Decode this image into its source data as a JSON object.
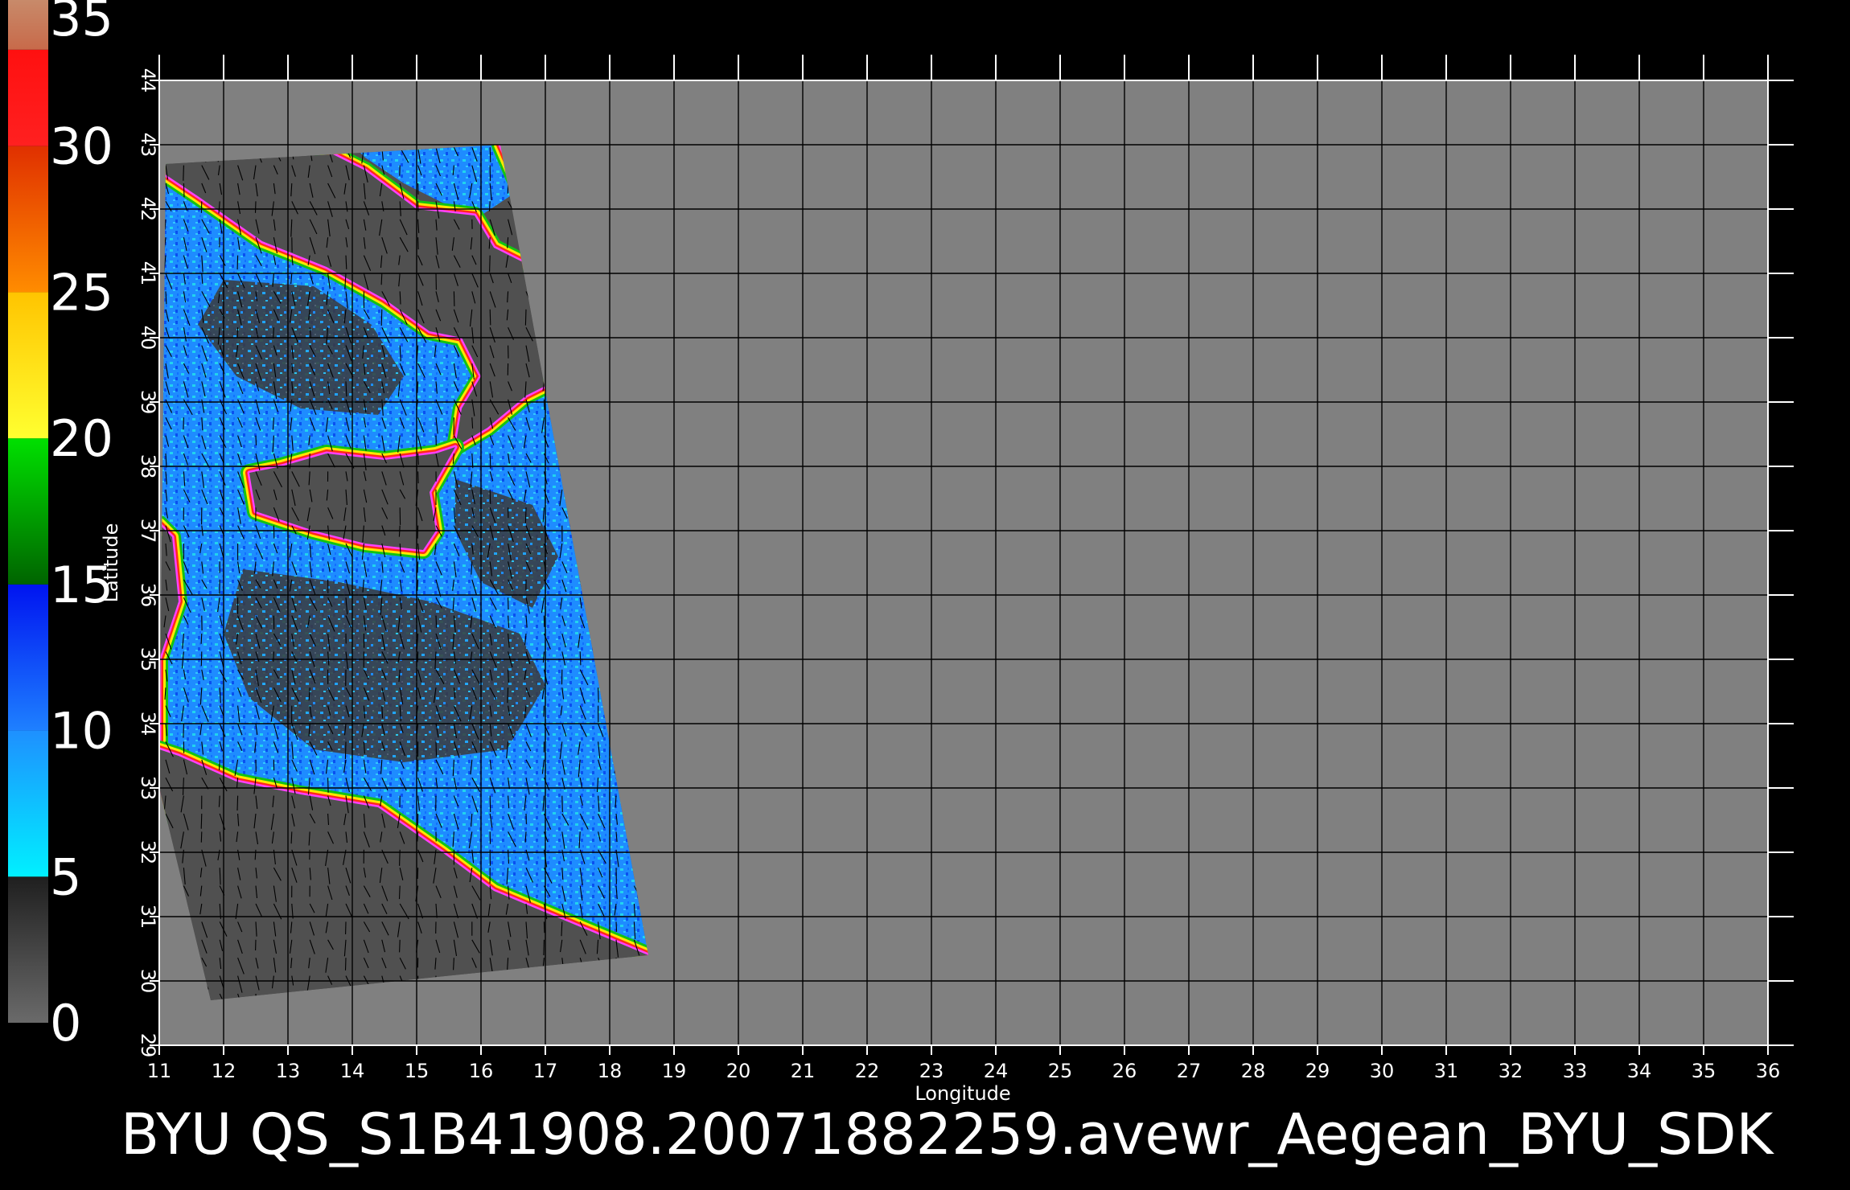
{
  "caption": "BYU  QS_S1B41908.20071882259.avewr_Aegean_BYU_SDK",
  "colors": {
    "background": "#000000",
    "map_fill": "#808080",
    "grid": "#000000",
    "swath_gray": "#505050",
    "land_patches": "#3c3c3c",
    "ocean_blue": "#1e90ff",
    "ocean_cyan": "#22d3ee",
    "ocean_deep_blue": "#0044ee",
    "coast_red": "#ff2a1a",
    "coast_yellow": "#ffe800",
    "coast_green": "#13c313",
    "coast_magenta": "#ff40ff",
    "wind_vector": "#000000"
  },
  "map": {
    "x_axis_label": "Longitude",
    "y_axis_label": "Latitude",
    "lon_range": [
      11,
      36
    ],
    "lat_range": [
      29,
      44
    ],
    "lon_ticks": [
      "11",
      "12",
      "13",
      "14",
      "15",
      "16",
      "17",
      "18",
      "19",
      "20",
      "21",
      "22",
      "23",
      "24",
      "25",
      "26",
      "27",
      "28",
      "29",
      "30",
      "31",
      "32",
      "33",
      "34",
      "35",
      "36"
    ],
    "lat_ticks": [
      "29",
      "30",
      "31",
      "32",
      "33",
      "34",
      "35",
      "36",
      "37",
      "38",
      "39",
      "40",
      "41",
      "42",
      "43",
      "44"
    ],
    "grid": true,
    "swath_corners_lonlat": [
      [
        11.1,
        42.7
      ],
      [
        16.3,
        43.0
      ],
      [
        18.6,
        30.4
      ],
      [
        11.8,
        29.7
      ],
      [
        11.0,
        33.0
      ]
    ]
  },
  "colorbar": {
    "orientation": "vertical",
    "placement": "left",
    "range": [
      0,
      35
    ],
    "tick_labels": [
      "0",
      "5",
      "10",
      "15",
      "20",
      "25",
      "30",
      "35"
    ],
    "segments": [
      {
        "from": 0,
        "to": 5,
        "color_bottom": "#6a6a6a",
        "color_top": "#1f1f1f"
      },
      {
        "from": 5,
        "to": 10,
        "color_bottom": "#00f0ff",
        "color_top": "#1e90ff"
      },
      {
        "from": 10,
        "to": 15,
        "color_bottom": "#1e80ff",
        "color_top": "#0014f0"
      },
      {
        "from": 15,
        "to": 20,
        "color_bottom": "#006400",
        "color_top": "#00e000"
      },
      {
        "from": 20,
        "to": 25,
        "color_bottom": "#ffff30",
        "color_top": "#ffc400"
      },
      {
        "from": 25,
        "to": 30,
        "color_bottom": "#ff8c00",
        "color_top": "#e03000"
      },
      {
        "from": 30,
        "to": 33.3,
        "color_bottom": "#ff2020",
        "color_top": "#ff1010"
      },
      {
        "from": 33.3,
        "to": 35,
        "color_bottom": "#c86a4a",
        "color_top": "#c88a6a"
      }
    ]
  }
}
